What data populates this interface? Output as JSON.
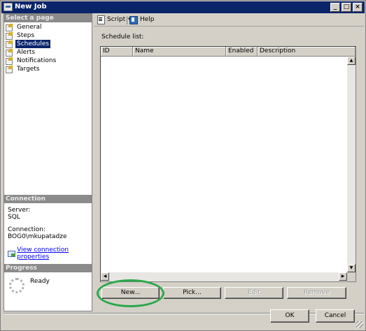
{
  "window": {
    "title": "New Job"
  },
  "title_buttons": {
    "minimize": "_",
    "maximize": "□",
    "close": "×"
  },
  "sidebar": {
    "select_header": "Select a page",
    "pages": [
      {
        "label": "General",
        "selected": false
      },
      {
        "label": "Steps",
        "selected": false
      },
      {
        "label": "Schedules",
        "selected": true
      },
      {
        "label": "Alerts",
        "selected": false
      },
      {
        "label": "Notifications",
        "selected": false
      },
      {
        "label": "Targets",
        "selected": false
      }
    ],
    "connection_header": "Connection",
    "server_label": "Server:",
    "server_value": "SQL",
    "connection_label": "Connection:",
    "connection_value": "BOG0\\mkupatadze",
    "view_connection_link": "View connection properties",
    "progress_header": "Progress",
    "progress_status": "Ready"
  },
  "toolbar": {
    "script_label": "Script",
    "help_label": "Help"
  },
  "main": {
    "schedule_list_label": "Schedule list:",
    "columns": [
      "ID",
      "Name",
      "Enabled",
      "Description"
    ],
    "buttons": {
      "new": "New...",
      "pick": "Pick...",
      "edit": "Edit",
      "remove": "Remove"
    }
  },
  "footer": {
    "ok": "OK",
    "cancel": "Cancel"
  },
  "colors": {
    "title_bar": "#0a246a",
    "highlight_circle": "#2aa84a",
    "link": "#0000ff"
  },
  "icons": [
    "window-icon",
    "page-icon",
    "script-icon",
    "help-icon",
    "connection-properties-icon",
    "progress-spinner-icon"
  ]
}
